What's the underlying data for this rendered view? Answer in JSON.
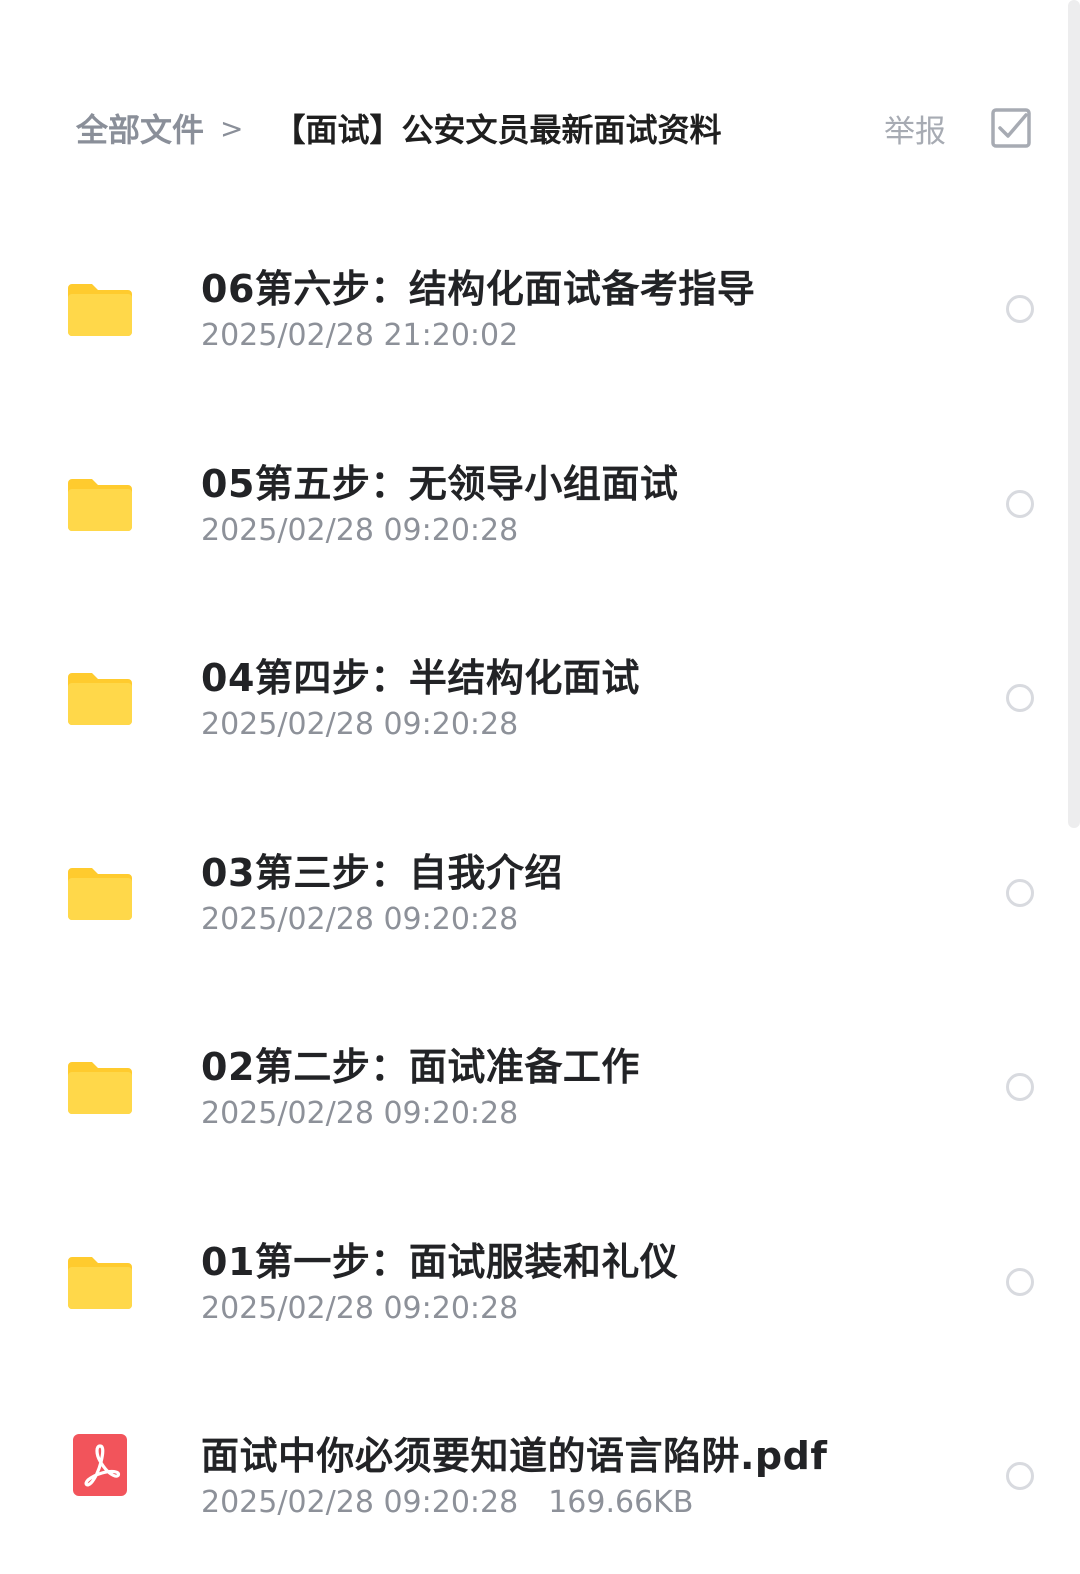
{
  "header": {
    "breadcrumb_root": "全部文件",
    "breadcrumb_separator": ">",
    "breadcrumb_current": "【面试】公安文员最新面试资料",
    "report_label": "举报",
    "select_icon": "checkbox-select-icon"
  },
  "files": [
    {
      "name": "06第六步：结构化面试备考指导",
      "date": "2025/02/28 21:20:02",
      "type": "folder",
      "icon": "folder-icon"
    },
    {
      "name": "05第五步：无领导小组面试",
      "date": "2025/02/28 09:20:28",
      "type": "folder",
      "icon": "folder-icon"
    },
    {
      "name": "04第四步：半结构化面试",
      "date": "2025/02/28 09:20:28",
      "type": "folder",
      "icon": "folder-icon"
    },
    {
      "name": "03第三步：自我介绍",
      "date": "2025/02/28 09:20:28",
      "type": "folder",
      "icon": "folder-icon"
    },
    {
      "name": "02第二步：面试准备工作",
      "date": "2025/02/28 09:20:28",
      "type": "folder",
      "icon": "folder-icon"
    },
    {
      "name": "01第一步：面试服装和礼仪",
      "date": "2025/02/28 09:20:28",
      "type": "folder",
      "icon": "folder-icon"
    },
    {
      "name": "面试中你必须要知道的语言陷阱.pdf",
      "date": "2025/02/28 09:20:28",
      "size": "169.66KB",
      "type": "pdf",
      "icon": "pdf-icon"
    }
  ],
  "colors": {
    "folder": "#FFD84A",
    "folder_tab": "#FFCB2E",
    "pdf": "#F2545B",
    "radio_border": "#D8DADF",
    "meta_text": "#8D9199"
  }
}
